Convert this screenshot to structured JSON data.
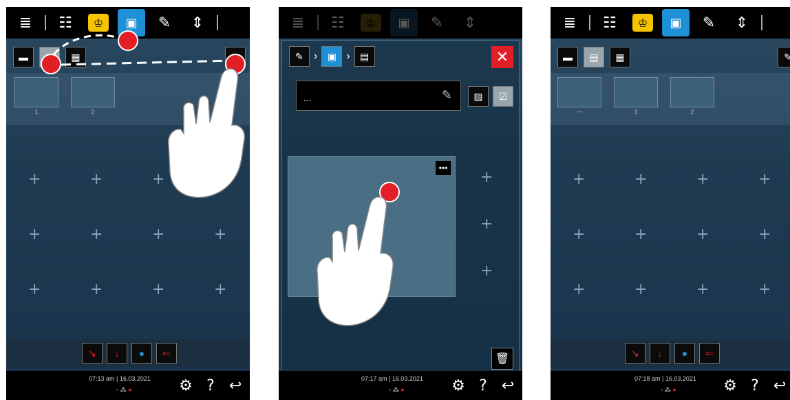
{
  "icons": {
    "menu": "≣",
    "filter": "☷",
    "chef_hat": "♔",
    "layout": "▣",
    "edit": "✎",
    "transfer": "⇕",
    "settings": "⚙",
    "help": "?",
    "back": "↩",
    "close": "✕",
    "more": "•••",
    "trash": "🗑",
    "plus": "+",
    "pencil": "✎",
    "image": "▨",
    "confirm": "☑"
  },
  "screens": [
    {
      "time": "07:13 am",
      "date": "16.03.2021",
      "templates": [
        "1",
        "2"
      ]
    },
    {
      "time": "07:17 am",
      "date": "16.03.2021",
      "name_value": "..."
    },
    {
      "time": "07:18 am",
      "date": "16.03.2021",
      "templates": [
        "—",
        "1",
        "2"
      ]
    }
  ],
  "colors": {
    "accent_red": "#e21f26",
    "accent_blue": "#1f8fd6",
    "accent_yellow": "#f5c400"
  }
}
